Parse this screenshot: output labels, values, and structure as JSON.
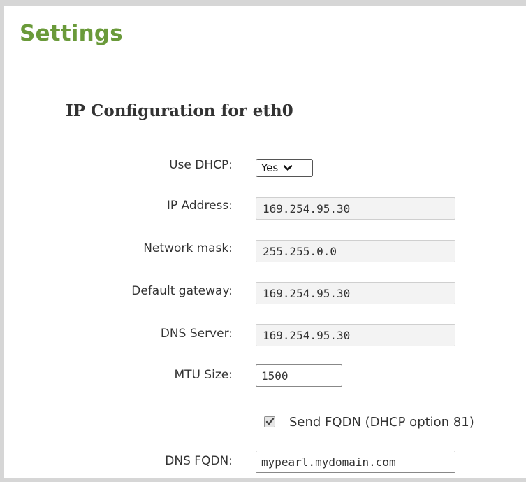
{
  "page": {
    "title": "Settings"
  },
  "section": {
    "title": "IP Configuration for eth0"
  },
  "form": {
    "use_dhcp": {
      "label": "Use DHCP:",
      "value": "Yes"
    },
    "ip_address": {
      "label": "IP Address:",
      "value": "169.254.95.30"
    },
    "network_mask": {
      "label": "Network mask:",
      "value": "255.255.0.0"
    },
    "default_gateway": {
      "label": "Default gateway:",
      "value": "169.254.95.30"
    },
    "dns_server": {
      "label": "DNS Server:",
      "value": "169.254.95.30"
    },
    "mtu_size": {
      "label": "MTU Size:",
      "value": "1500"
    },
    "send_fqdn": {
      "label": "Send FQDN (DHCP option 81)",
      "checked": true
    },
    "dns_fqdn": {
      "label": "DNS FQDN:",
      "value": "mypearl.mydomain.com"
    }
  },
  "icons": {
    "select_arrow": "chevron-down-icon",
    "checkbox_mark": "checkmark-icon"
  },
  "colors": {
    "title_green": "#6a9a3a",
    "frame_gray": "#d6d6d6",
    "readonly_bg": "#f3f3f3"
  }
}
